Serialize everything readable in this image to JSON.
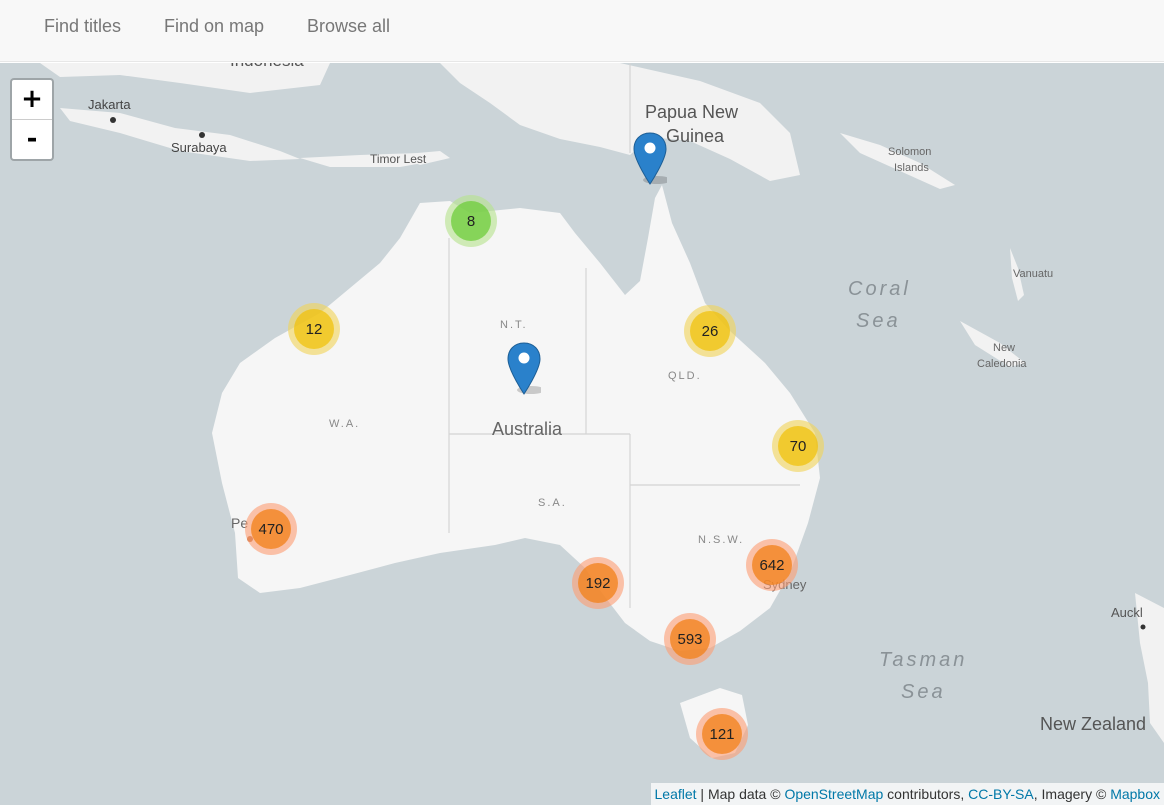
{
  "nav": {
    "items": [
      {
        "label": "Find titles"
      },
      {
        "label": "Find on map"
      },
      {
        "label": "Browse all"
      }
    ]
  },
  "map": {
    "zoom_in": "+",
    "zoom_out": "-",
    "labels": {
      "indonesia": "Indonesia",
      "jakarta": "Jakarta",
      "surabaya": "Surabaya",
      "timor_lest": "Timor Lest",
      "png_line1": "Papua New",
      "png_line2": "Guinea",
      "solomon_line1": "Solomon",
      "solomon_line2": "Islands",
      "vanuatu": "Vanuatu",
      "coral_line1": "Coral",
      "coral_line2": "Sea",
      "new_caledonia_line1": "New",
      "new_caledonia_line2": "Caledonia",
      "nt": "N.T.",
      "qld": "QLD.",
      "wa": "W.A.",
      "australia": "Australia",
      "sa": "S.A.",
      "nsw": "N.S.W.",
      "perth_partial": "Pe",
      "sydney": "Sydney",
      "tasman_line1": "Tasman",
      "tasman_line2": "Sea",
      "auckland_partial": "Auckl",
      "new_zealand": "New Zealand"
    },
    "clusters": [
      {
        "count": "8",
        "size": "small"
      },
      {
        "count": "12",
        "size": "medium"
      },
      {
        "count": "26",
        "size": "medium"
      },
      {
        "count": "70",
        "size": "medium"
      },
      {
        "count": "470",
        "size": "large"
      },
      {
        "count": "642",
        "size": "large"
      },
      {
        "count": "192",
        "size": "large"
      },
      {
        "count": "593",
        "size": "large"
      },
      {
        "count": "121",
        "size": "large"
      }
    ],
    "marker_color": "#2a81cb"
  },
  "attribution": {
    "leaflet": "Leaflet",
    "sep1": " | Map data © ",
    "osm": "OpenStreetMap",
    "sep2": " contributors, ",
    "license": "CC-BY-SA",
    "sep3": ", Imagery © ",
    "imagery": "Mapbox"
  }
}
